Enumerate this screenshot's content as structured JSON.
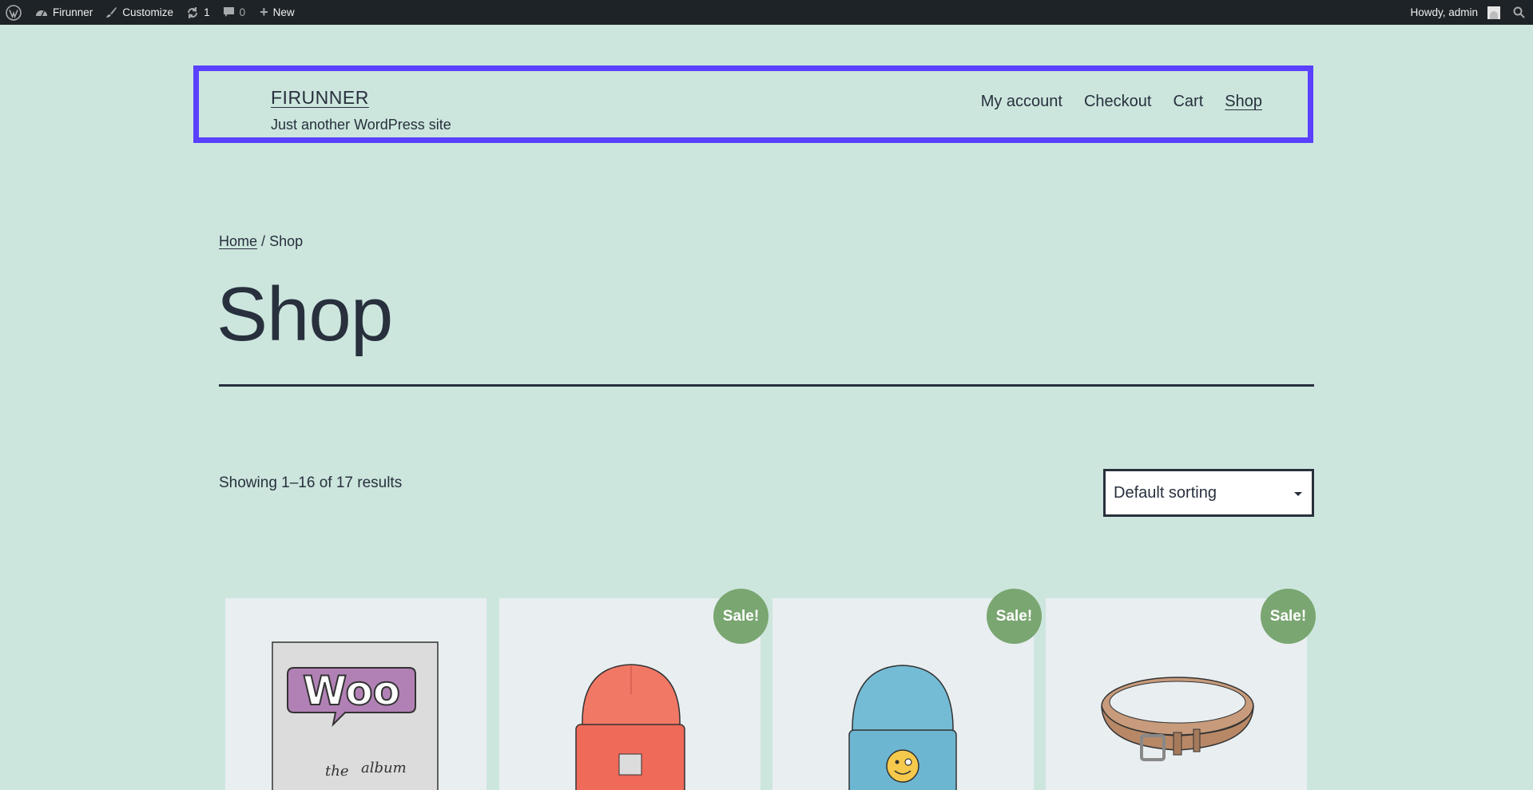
{
  "adminbar": {
    "site_name": "Firunner",
    "customize": "Customize",
    "updates_count": "1",
    "comments_count": "0",
    "new_label": "New",
    "howdy": "Howdy, admin"
  },
  "header": {
    "site_title": "FIRUNNER",
    "tagline": "Just another WordPress site",
    "nav": [
      "My account",
      "Checkout",
      "Cart",
      "Shop"
    ],
    "current_nav": "Shop",
    "highlight_color": "#5a40ff"
  },
  "breadcrumb": {
    "home": "Home",
    "separator": "/",
    "current": "Shop"
  },
  "page_title": "Shop",
  "result_count": "Showing 1–16 of 17 results",
  "ordering": {
    "selected": "Default sorting"
  },
  "products": [
    {
      "image": "woo-album-cover",
      "sale": ""
    },
    {
      "image": "red-beanie",
      "sale": "Sale!"
    },
    {
      "image": "blue-beanie-with-logo",
      "sale": "Sale!"
    },
    {
      "image": "brown-leather-belt",
      "sale": "Sale!"
    }
  ],
  "colors": {
    "background": "#cce6dd",
    "sale_badge": "#7aa671",
    "text": "#28303d"
  }
}
